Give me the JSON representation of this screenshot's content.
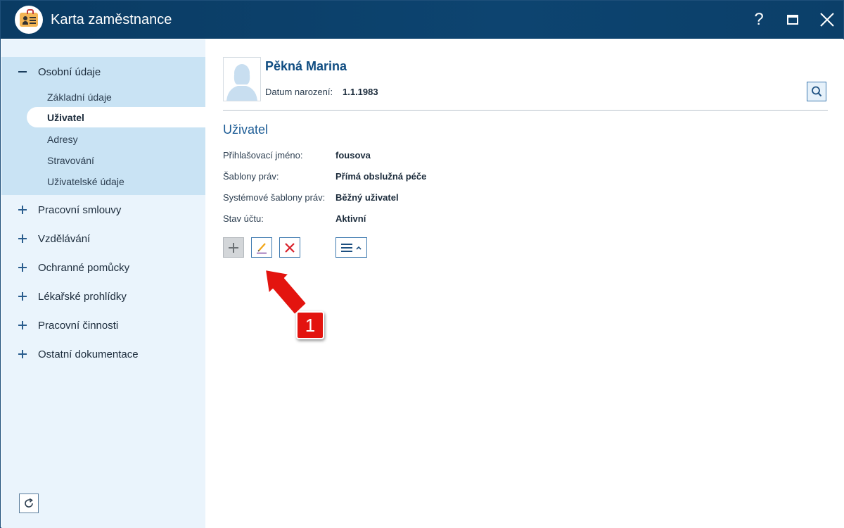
{
  "window": {
    "title": "Karta zaměstnance",
    "help_label": "?"
  },
  "sidebar": {
    "open_section": {
      "label": "Osobní údaje",
      "items": [
        {
          "label": "Základní údaje",
          "active": false
        },
        {
          "label": "Uživatel",
          "active": true
        },
        {
          "label": "Adresy",
          "active": false
        },
        {
          "label": "Stravování",
          "active": false
        },
        {
          "label": "Uživatelské údaje",
          "active": false
        }
      ]
    },
    "sections": [
      {
        "label": "Pracovní smlouvy"
      },
      {
        "label": "Vzdělávání"
      },
      {
        "label": "Ochranné pomůcky"
      },
      {
        "label": "Lékařské prohlídky"
      },
      {
        "label": "Pracovní činnosti"
      },
      {
        "label": "Ostatní dokumentace"
      }
    ]
  },
  "employee": {
    "name": "Pěkná Marina",
    "dob_label": "Datum narození:",
    "dob_value": "1.1.1983"
  },
  "user_section": {
    "title": "Uživatel",
    "fields": [
      {
        "label": "Přihlašovací jméno:",
        "value": "fousova"
      },
      {
        "label": "Šablony práv:",
        "value": "Přímá obslužná péče"
      },
      {
        "label": "Systémové šablony práv:",
        "value": "Běžný uživatel"
      },
      {
        "label": "Stav účtu:",
        "value": "Aktivní"
      }
    ]
  },
  "callout": {
    "number": "1"
  },
  "colors": {
    "titlebar": "#0a3b63",
    "sidebar_bg": "#eaf4fc",
    "sidebar_open_bg": "#c9e3f4",
    "accent": "#1c5c95",
    "callout_red": "#e3140f"
  }
}
